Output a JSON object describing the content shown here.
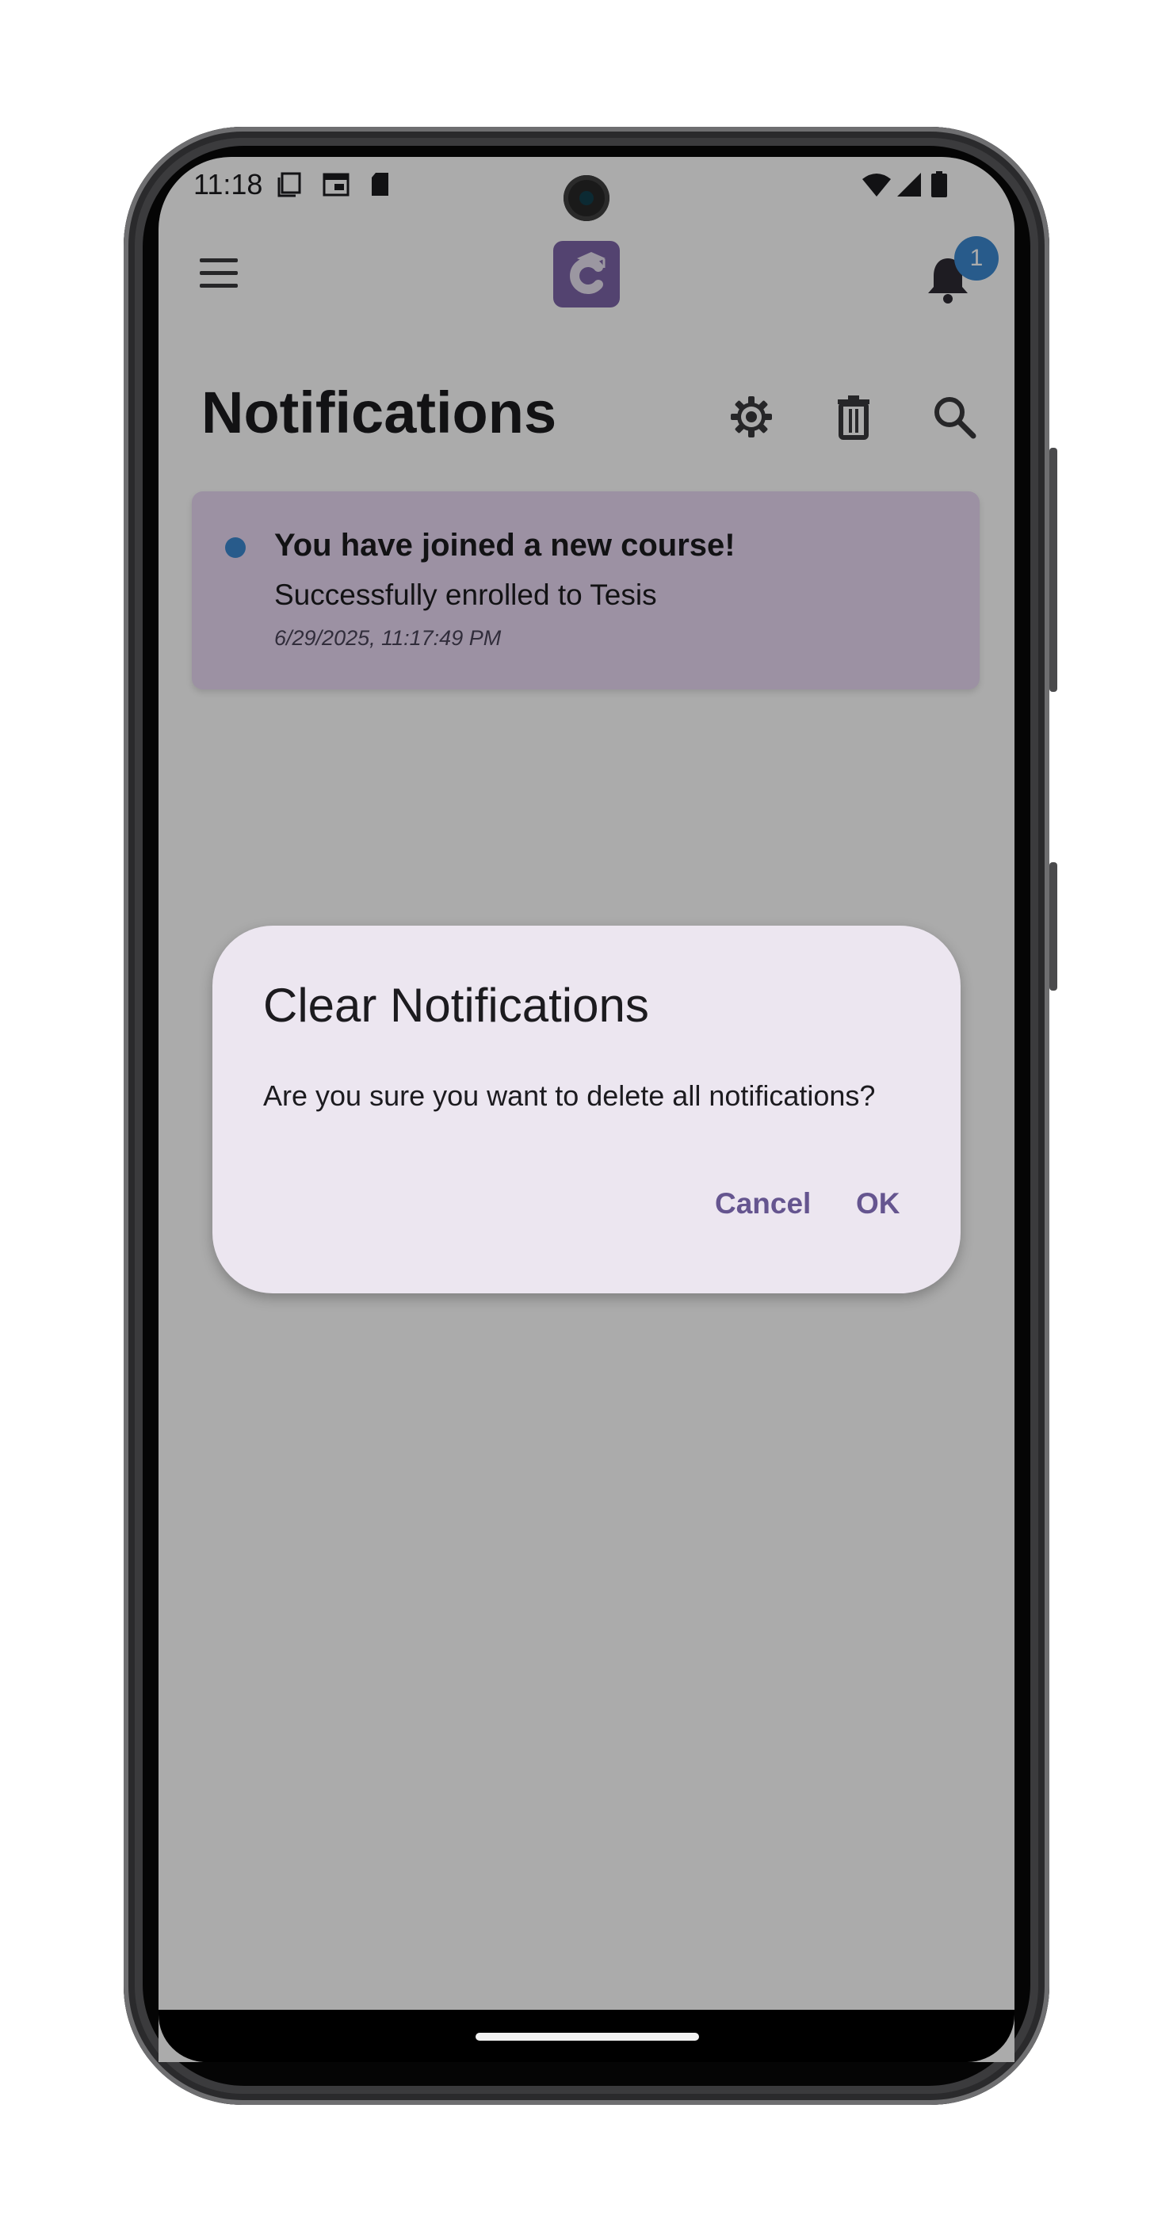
{
  "status_bar": {
    "time": "11:18"
  },
  "app_bar": {
    "notification_count": "1"
  },
  "page": {
    "title": "Notifications"
  },
  "notifications": [
    {
      "title": "You have joined a new course!",
      "body": "Successfully enrolled to Tesis",
      "timestamp": "6/29/2025, 11:17:49 PM"
    }
  ],
  "dialog": {
    "title": "Clear Notifications",
    "message": "Are you sure you want to delete all notifications?",
    "cancel_label": "Cancel",
    "ok_label": "OK"
  },
  "colors": {
    "brand_purple": "#7d64a8",
    "badge_blue": "#3c88cf",
    "dialog_button": "#65558f",
    "card_background": "#e9d9f4"
  }
}
